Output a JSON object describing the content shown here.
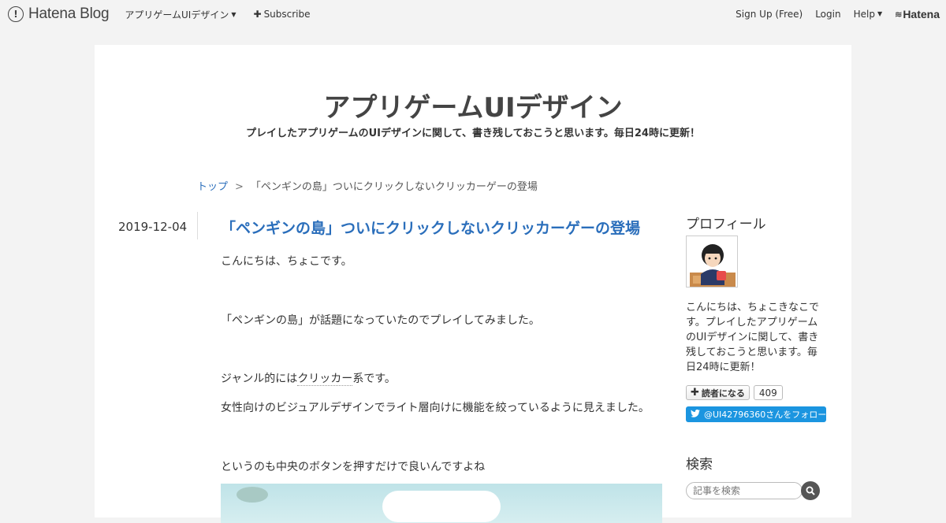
{
  "globalbar": {
    "logo_text": "Hatena Blog",
    "blog_menu": "アプリゲームUIデザイン",
    "subscribe": "Subscribe",
    "signup": "Sign Up (Free)",
    "login": "Login",
    "help": "Help",
    "hatena": "Hatena"
  },
  "blog": {
    "title": "アプリゲームUIデザイン",
    "description": "プレイしたアプリゲームのUIデザインに関して、書き残しておこうと思います。毎日24時に更新！"
  },
  "breadcrumb": {
    "top": "トップ",
    "separator": ">",
    "current": "「ペンギンの島」ついにクリックしないクリッカーゲーの登場"
  },
  "entry": {
    "date": "2019-12-04",
    "title": "「ペンギンの島」ついにクリックしないクリッカーゲーの登場",
    "p1": "こんにちは、ちょこです。",
    "p2": "「ペンギンの島」が話題になっていたのでプレイしてみました。",
    "p3_pre": "ジャンル的には",
    "p3_kw": "クリッカー",
    "p3_post": "系です。",
    "p4": "女性向けのビジュアルデザインでライト層向けに機能を絞っているように見えました。",
    "p5": "というのも中央のボタンを押すだけで良いんですよね"
  },
  "sidebar": {
    "profile_heading": "プロフィール",
    "profile_text": "こんにちは、ちょこきなこです。プレイしたアプリゲームのUIデザインに関して、書き残しておこうと思います。毎日24時に更新！",
    "readers_label": "読者になる",
    "readers_count": "409",
    "twitter_label": "@UI42796360さんをフォロー",
    "search_heading": "検索",
    "search_placeholder": "記事を検索"
  }
}
